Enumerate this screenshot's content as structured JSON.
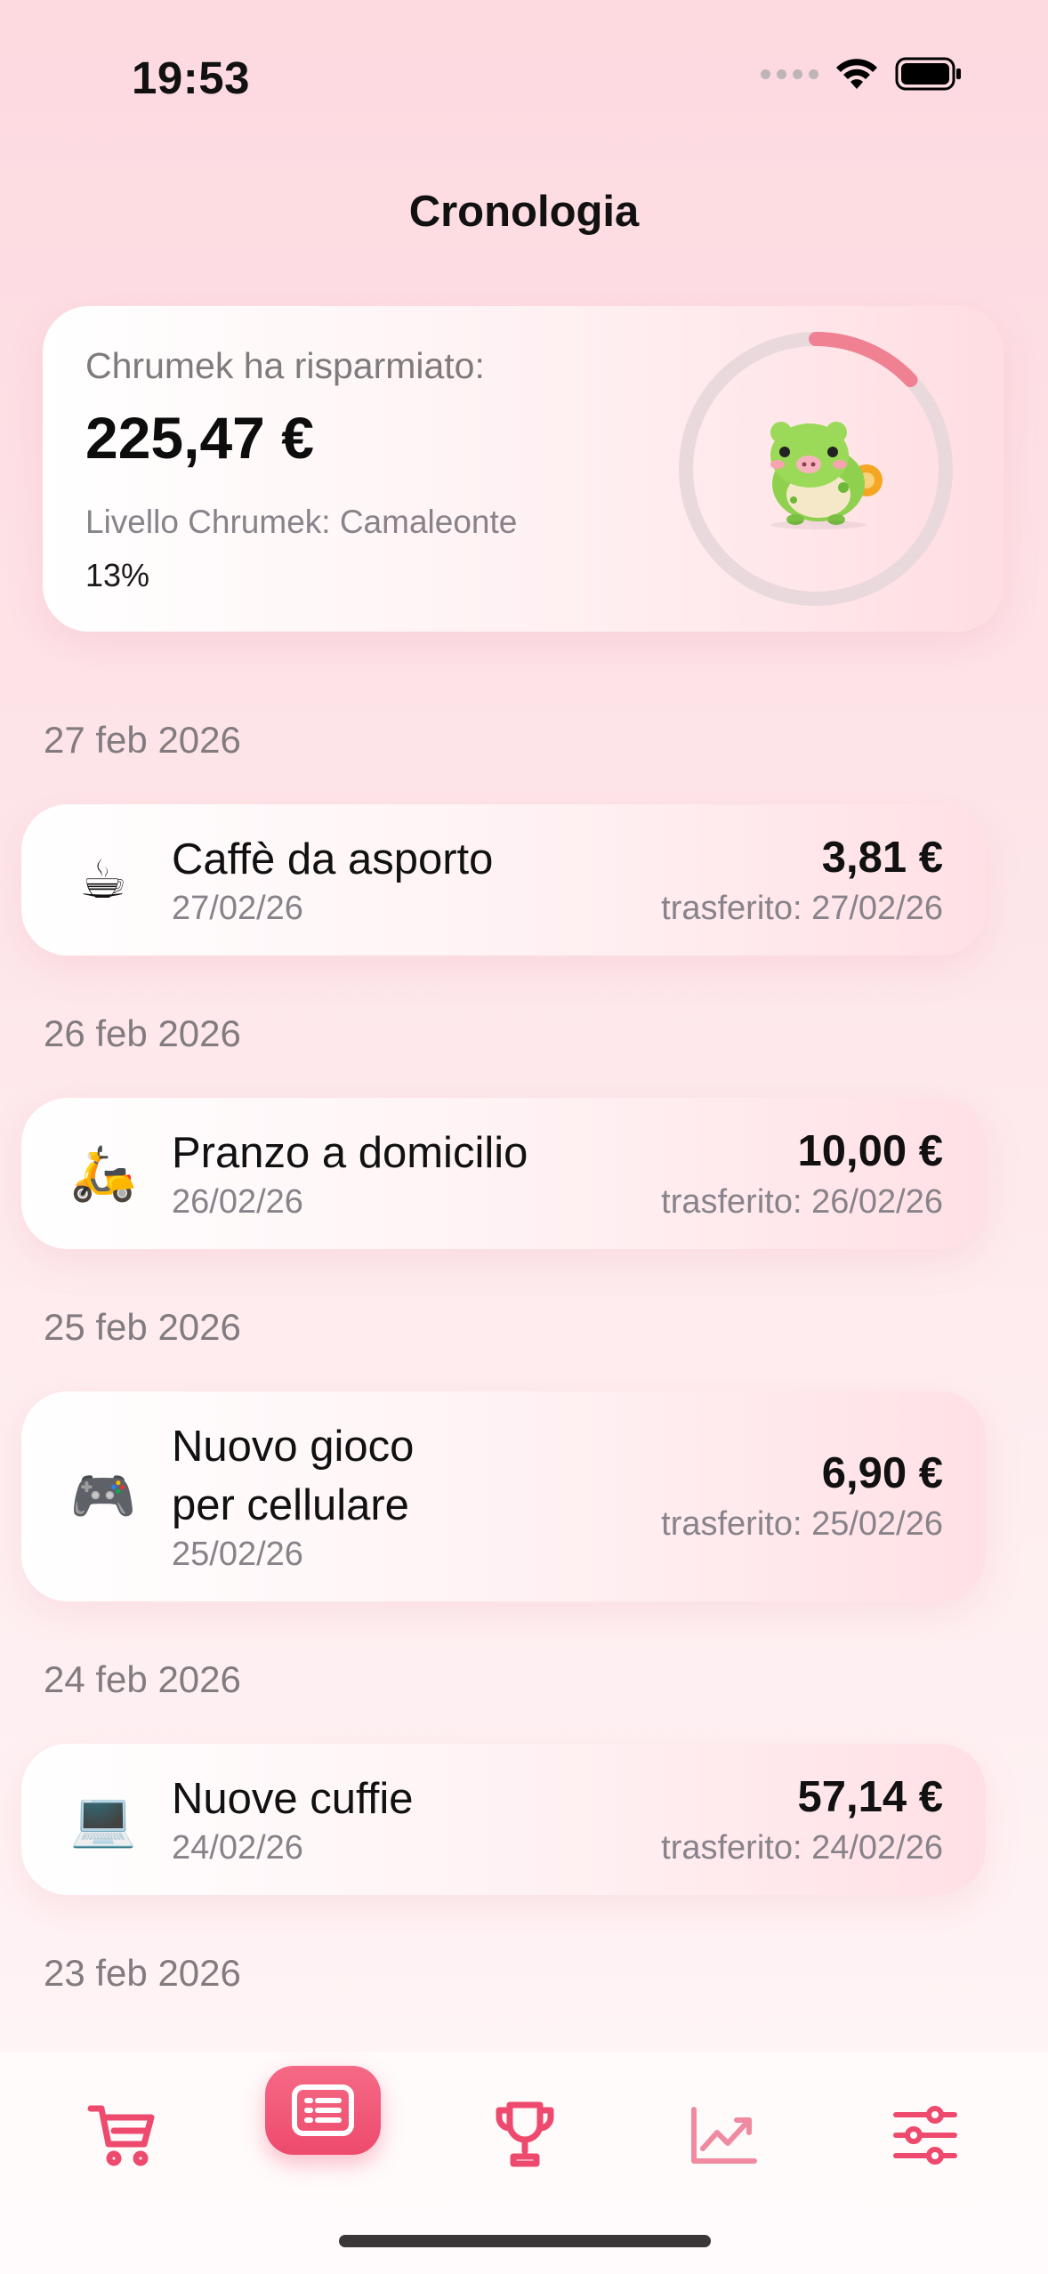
{
  "status": {
    "time": "19:53"
  },
  "header": {
    "title": "Cronologia"
  },
  "summary": {
    "label": "Chrumek ha risparmiato:",
    "amount": "225,47 €",
    "level": "Livello Chrumek: Camaleonte",
    "percent_text": "13%",
    "progress": 0.13,
    "mascot": "chameleon-pig-mascot"
  },
  "entries": [
    {
      "section_date": "27 feb 2026",
      "icon": "coffee-cup-icon",
      "emoji": "☕",
      "name_lines": [
        "Caffè da asporto"
      ],
      "date": "27/02/26",
      "amount": "3,81 €",
      "transfer": "trasferito: 27/02/26"
    },
    {
      "section_date": "26 feb 2026",
      "icon": "scooter-icon",
      "emoji": "🛵",
      "name_lines": [
        "Pranzo a domicilio"
      ],
      "date": "26/02/26",
      "amount": "10,00 €",
      "transfer": "trasferito: 26/02/26"
    },
    {
      "section_date": "25 feb 2026",
      "icon": "game-controller-icon",
      "emoji": "🎮",
      "name_lines": [
        "Nuovo gioco",
        "per cellulare"
      ],
      "date": "25/02/26",
      "amount": "6,90 €",
      "transfer": "trasferito: 25/02/26"
    },
    {
      "section_date": "24 feb 2026",
      "icon": "laptop-icon",
      "emoji": "💻",
      "name_lines": [
        "Nuove cuffie"
      ],
      "date": "24/02/26",
      "amount": "57,14 €",
      "transfer": "trasferito: 24/02/26"
    }
  ],
  "next_section_date": "23 feb 2026",
  "tabs": [
    {
      "icon": "cart-icon",
      "active": false
    },
    {
      "icon": "list-icon",
      "active": true
    },
    {
      "icon": "trophy-icon",
      "active": false
    },
    {
      "icon": "chart-trend-icon",
      "active": false
    },
    {
      "icon": "sliders-icon",
      "active": false
    }
  ],
  "colors": {
    "accent": "#ee4a6d",
    "ring_track": "#e9d7da",
    "ring_fill": "#ef8193"
  }
}
